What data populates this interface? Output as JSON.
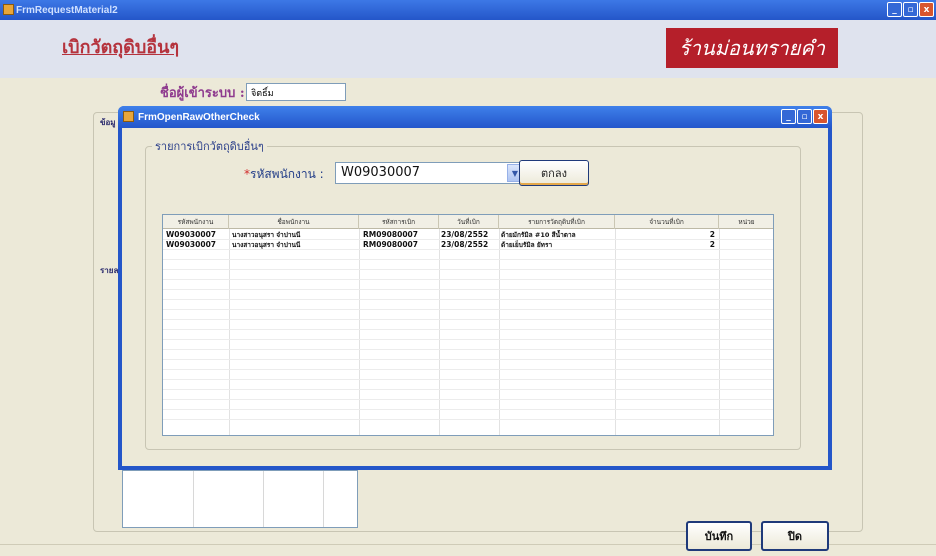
{
  "outer_window": {
    "title": "FrmRequestMaterial2",
    "controls": {
      "minimize": "_",
      "maximize": "▫",
      "close": "x"
    }
  },
  "header": {
    "title": "เบิกวัตถุดิบอื่นๆ",
    "shop_logo": "ร้านม่อนทรายคำ"
  },
  "user": {
    "label": "ชื่อผู้เข้าระบบ :",
    "value": "จิตธิ์ม"
  },
  "side_labels": {
    "info": "ข้อมู",
    "list": "รายล"
  },
  "buttons": {
    "save": "บันทึก",
    "close": "ปิด"
  },
  "dialog": {
    "title": "FrmOpenRawOtherCheck",
    "controls": {
      "minimize": "_",
      "maximize": "▫",
      "close": "x"
    },
    "group_title": "รายการเบิกวัตถุดิบอื่นๆ",
    "employee_label": "รหัสพนักงาน :",
    "required_mark": "*",
    "employee_value": "W09030007",
    "ok_button": "ตกลง",
    "grid": {
      "columns": [
        "รหัสพนักงาน",
        "ชื่อพนักงาน",
        "รหัสการเบิก",
        "วันที่เบิก",
        "รายการวัตถุดิบที่เบิก",
        "จำนวนที่เบิก",
        "หน่วย"
      ],
      "rows": [
        [
          "W09030007",
          "นางสาวอนุสรา จ๋าปานนี",
          "RM09080007",
          "23/08/2552",
          "ด้ายมักรัมิล #10 สีน้ำตาล",
          "2",
          ""
        ],
        [
          "W09030007",
          "นางสาวอนุสรา จ๋าปานนี",
          "RM09080007",
          "23/08/2552",
          "ด้ายเย็บรัมิล ยัทรา",
          "2",
          ""
        ]
      ]
    }
  },
  "colors": {
    "title_blue": "#2456c9",
    "header_red": "#b5333d",
    "logo_bg": "#b51f2a",
    "window_face": "#ece9d8"
  }
}
